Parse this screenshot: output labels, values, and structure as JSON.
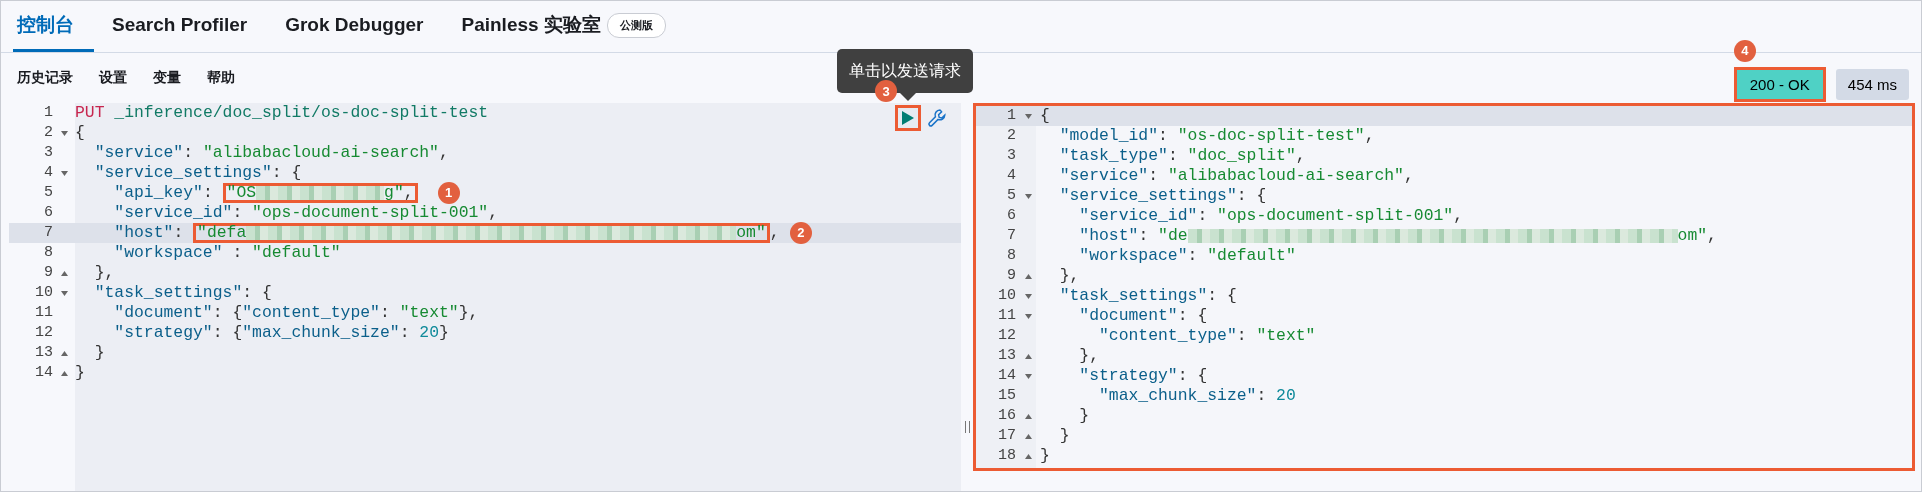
{
  "tabs": [
    {
      "label": "控制台",
      "selected": true
    },
    {
      "label": "Search Profiler",
      "selected": false
    },
    {
      "label": "Grok Debugger",
      "selected": false
    },
    {
      "label": "Painless 实验室",
      "selected": false,
      "badge": "公测版"
    }
  ],
  "toolbar": [
    "历史记录",
    "设置",
    "变量",
    "帮助"
  ],
  "run_button": {
    "tooltip": "单击以发送请求",
    "callout": "3"
  },
  "status": {
    "code": "200 - OK",
    "callout": "4",
    "time": "454 ms"
  },
  "request_editor": {
    "lines": [
      {
        "n": "1",
        "tokens": [
          {
            "kind": "method",
            "t": "PUT"
          },
          {
            "kind": "url",
            "t": " _inference/doc_split/os-doc-split-test"
          }
        ]
      },
      {
        "n": "2",
        "fold": {
          "kind": "start"
        },
        "tokens": [
          {
            "kind": "punct",
            "t": "{"
          }
        ]
      },
      {
        "n": "3",
        "tokens": [
          {
            "kind": "key",
            "t": "  \"service\""
          },
          {
            "kind": "punct",
            "t": ": "
          },
          {
            "kind": "str",
            "t": "\"alibabacloud-ai-search\""
          },
          {
            "kind": "punct",
            "t": ","
          }
        ]
      },
      {
        "n": "4",
        "fold": {
          "kind": "start"
        },
        "tokens": [
          {
            "kind": "key",
            "t": "  \"service_settings\""
          },
          {
            "kind": "punct",
            "t": ": {"
          }
        ]
      },
      {
        "n": "5",
        "tokens": [
          {
            "kind": "key",
            "t": "    \"api_key\""
          },
          {
            "kind": "punct",
            "t": ": "
          },
          {
            "kind": "group",
            "callout": "1",
            "parts": [
              {
                "kind": "str",
                "t": "\"OS"
              },
              {
                "kind": "redacted_short"
              },
              {
                "kind": "str",
                "t": "g\""
              },
              {
                "kind": "punct",
                "t": ","
              }
            ]
          }
        ]
      },
      {
        "n": "6",
        "tokens": [
          {
            "kind": "key",
            "t": "    \"service_id\""
          },
          {
            "kind": "punct",
            "t": ": "
          },
          {
            "kind": "str",
            "t": "\"ops-document-split-001\""
          },
          {
            "kind": "punct",
            "t": ","
          }
        ]
      },
      {
        "n": "7",
        "active": true,
        "tokens": [
          {
            "kind": "key",
            "t": "    \"host\""
          },
          {
            "kind": "punct",
            "t": ": "
          },
          {
            "kind": "group",
            "callout": "2",
            "parts": [
              {
                "kind": "str",
                "t": "\"defa"
              },
              {
                "kind": "redacted_long"
              },
              {
                "kind": "str",
                "t": "om\""
              }
            ]
          },
          {
            "kind": "punct",
            "t": ","
          }
        ]
      },
      {
        "n": "8",
        "tokens": [
          {
            "kind": "key",
            "t": "    \"workspace\""
          },
          {
            "kind": "punct",
            "t": " : "
          },
          {
            "kind": "str",
            "t": "\"default\""
          }
        ]
      },
      {
        "n": "9",
        "fold": {
          "kind": "end"
        },
        "tokens": [
          {
            "kind": "punct",
            "t": "  },"
          }
        ]
      },
      {
        "n": "10",
        "fold": {
          "kind": "start"
        },
        "tokens": [
          {
            "kind": "key",
            "t": "  \"task_settings\""
          },
          {
            "kind": "punct",
            "t": ": {"
          }
        ]
      },
      {
        "n": "11",
        "tokens": [
          {
            "kind": "key",
            "t": "    \"document\""
          },
          {
            "kind": "punct",
            "t": ": {"
          },
          {
            "kind": "key",
            "t": "\"content_type\""
          },
          {
            "kind": "punct",
            "t": ": "
          },
          {
            "kind": "str",
            "t": "\"text\""
          },
          {
            "kind": "punct",
            "t": "},"
          }
        ]
      },
      {
        "n": "12",
        "tokens": [
          {
            "kind": "key",
            "t": "    \"strategy\""
          },
          {
            "kind": "punct",
            "t": ": {"
          },
          {
            "kind": "key",
            "t": "\"max_chunk_size\""
          },
          {
            "kind": "punct",
            "t": ": "
          },
          {
            "kind": "num",
            "t": "20"
          },
          {
            "kind": "punct",
            "t": "}"
          }
        ]
      },
      {
        "n": "13",
        "fold": {
          "kind": "end"
        },
        "tokens": [
          {
            "kind": "punct",
            "t": "  }"
          }
        ]
      },
      {
        "n": "14",
        "fold": {
          "kind": "end"
        },
        "tokens": [
          {
            "kind": "punct",
            "t": "}"
          }
        ]
      }
    ]
  },
  "response_editor": {
    "boxed": true,
    "lines": [
      {
        "n": "1",
        "fold": {
          "kind": "start"
        },
        "active": true,
        "tokens": [
          {
            "kind": "punct",
            "t": "{"
          }
        ]
      },
      {
        "n": "2",
        "tokens": [
          {
            "kind": "key",
            "t": "  \"model_id\""
          },
          {
            "kind": "punct",
            "t": ": "
          },
          {
            "kind": "str",
            "t": "\"os-doc-split-test\""
          },
          {
            "kind": "punct",
            "t": ","
          }
        ]
      },
      {
        "n": "3",
        "tokens": [
          {
            "kind": "key",
            "t": "  \"task_type\""
          },
          {
            "kind": "punct",
            "t": ": "
          },
          {
            "kind": "str",
            "t": "\"doc_split\""
          },
          {
            "kind": "punct",
            "t": ","
          }
        ]
      },
      {
        "n": "4",
        "tokens": [
          {
            "kind": "key",
            "t": "  \"service\""
          },
          {
            "kind": "punct",
            "t": ": "
          },
          {
            "kind": "str",
            "t": "\"alibabacloud-ai-search\""
          },
          {
            "kind": "punct",
            "t": ","
          }
        ]
      },
      {
        "n": "5",
        "fold": {
          "kind": "start"
        },
        "tokens": [
          {
            "kind": "key",
            "t": "  \"service_settings\""
          },
          {
            "kind": "punct",
            "t": ": {"
          }
        ]
      },
      {
        "n": "6",
        "tokens": [
          {
            "kind": "key",
            "t": "    \"service_id\""
          },
          {
            "kind": "punct",
            "t": ": "
          },
          {
            "kind": "str",
            "t": "\"ops-document-split-001\""
          },
          {
            "kind": "punct",
            "t": ","
          }
        ]
      },
      {
        "n": "7",
        "tokens": [
          {
            "kind": "key",
            "t": "    \"host\""
          },
          {
            "kind": "punct",
            "t": ": "
          },
          {
            "kind": "str",
            "t": "\"de"
          },
          {
            "kind": "redacted_long"
          },
          {
            "kind": "str",
            "t": "om\""
          },
          {
            "kind": "punct",
            "t": ","
          }
        ]
      },
      {
        "n": "8",
        "tokens": [
          {
            "kind": "key",
            "t": "    \"workspace\""
          },
          {
            "kind": "punct",
            "t": ": "
          },
          {
            "kind": "str",
            "t": "\"default\""
          }
        ]
      },
      {
        "n": "9",
        "fold": {
          "kind": "end"
        },
        "tokens": [
          {
            "kind": "punct",
            "t": "  },"
          }
        ]
      },
      {
        "n": "10",
        "fold": {
          "kind": "start"
        },
        "tokens": [
          {
            "kind": "key",
            "t": "  \"task_settings\""
          },
          {
            "kind": "punct",
            "t": ": {"
          }
        ]
      },
      {
        "n": "11",
        "fold": {
          "kind": "start"
        },
        "tokens": [
          {
            "kind": "key",
            "t": "    \"document\""
          },
          {
            "kind": "punct",
            "t": ": {"
          }
        ]
      },
      {
        "n": "12",
        "tokens": [
          {
            "kind": "key",
            "t": "      \"content_type\""
          },
          {
            "kind": "punct",
            "t": ": "
          },
          {
            "kind": "str",
            "t": "\"text\""
          }
        ]
      },
      {
        "n": "13",
        "fold": {
          "kind": "end"
        },
        "tokens": [
          {
            "kind": "punct",
            "t": "    },"
          }
        ]
      },
      {
        "n": "14",
        "fold": {
          "kind": "start"
        },
        "tokens": [
          {
            "kind": "key",
            "t": "    \"strategy\""
          },
          {
            "kind": "punct",
            "t": ": {"
          }
        ]
      },
      {
        "n": "15",
        "tokens": [
          {
            "kind": "key",
            "t": "      \"max_chunk_size\""
          },
          {
            "kind": "punct",
            "t": ": "
          },
          {
            "kind": "num",
            "t": "20"
          }
        ]
      },
      {
        "n": "16",
        "fold": {
          "kind": "end"
        },
        "tokens": [
          {
            "kind": "punct",
            "t": "    }"
          }
        ]
      },
      {
        "n": "17",
        "fold": {
          "kind": "end"
        },
        "tokens": [
          {
            "kind": "punct",
            "t": "  }"
          }
        ]
      },
      {
        "n": "18",
        "fold": {
          "kind": "end"
        },
        "tokens": [
          {
            "kind": "punct",
            "t": "}"
          }
        ]
      }
    ]
  }
}
